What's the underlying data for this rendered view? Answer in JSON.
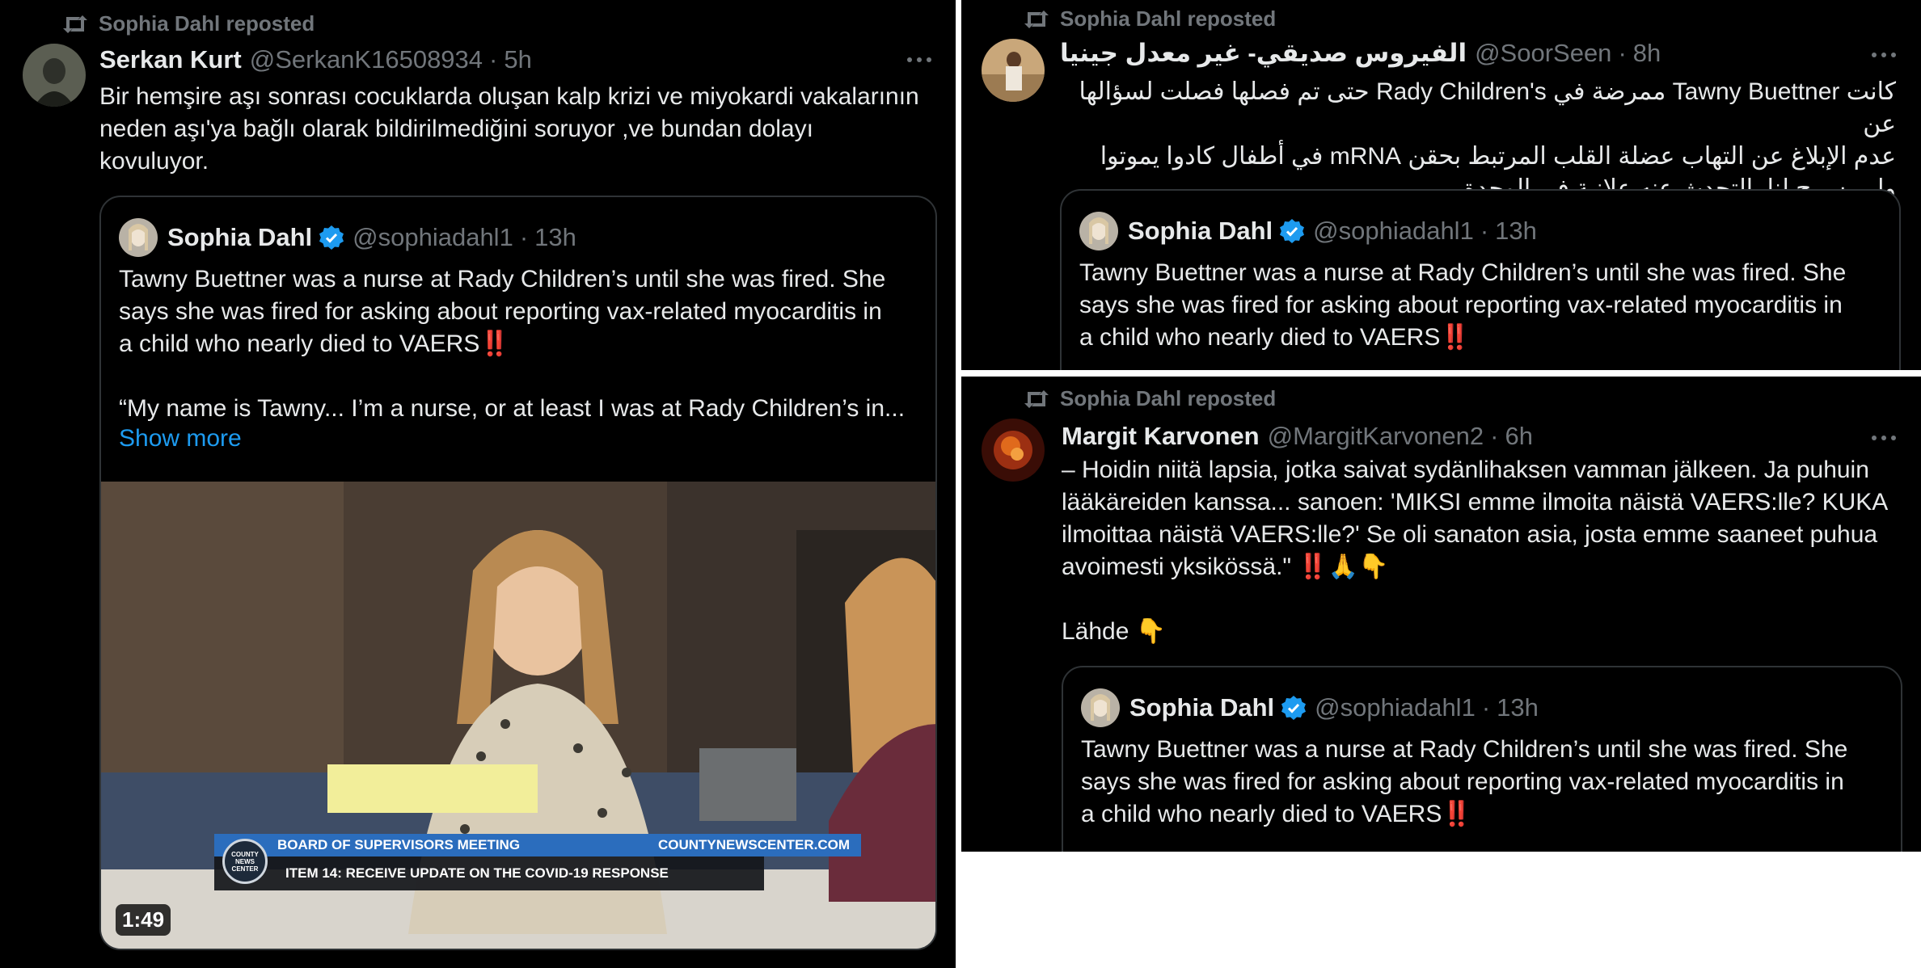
{
  "left": {
    "repost_label": "Sophia Dahl reposted",
    "author_name": "Serkan Kurt",
    "author_handle": "@SerkanK16508934",
    "separator": "·",
    "time": "5h",
    "text": "Bir hemşire aşı sonrası cocuklarda oluşan kalp krizi ve miyokardi vakalarının\nneden aşı'ya bağlı olarak bildirilmediğini soruyor ,ve bundan dolayı\nkovuluyor.",
    "quote": {
      "name": "Sophia Dahl",
      "handle": "@sophiadahl1",
      "time": "13h",
      "text_part1": "Tawny Buettner was a nurse at Rady Children’s until she was fired. She\nsays she was fired for asking about reporting vax-related myocarditis in\na child who nearly died to VAERS",
      "emoji_bang": "‼️",
      "text_part2": "“My name is Tawny... I’m a nurse, or at least I was at Rady Children’s in...",
      "show_more": "Show more"
    },
    "video": {
      "banner_title": "BOARD OF SUPERVISORS MEETING",
      "banner_site": "COUNTYNEWSCENTER.COM",
      "banner_item": "ITEM 14: RECEIVE UPDATE ON THE COVID-19 RESPONSE",
      "logo_text": "COUNTY NEWS CENTER",
      "duration": "1:49"
    }
  },
  "top_right": {
    "repost_label": "Sophia Dahl reposted",
    "author_name": "الفيروس صديقي- غير معدل جينيا",
    "author_handle": "@SoorSeen",
    "separator": "·",
    "time": "8h",
    "text": "كانت Tawny Buettner ممرضة في Rady Children's حتى تم فصلها فصلت لسؤالها عن\nعدم الإبلاغ عن التهاب عضلة القلب المرتبط بحقن mRNA في أطفال كادوا يموتوا\nولم يسمح لنا بالتحدث عنه علانية في الوحدة",
    "quote": {
      "name": "Sophia Dahl",
      "handle": "@sophiadahl1",
      "time": "13h",
      "text_part1": "Tawny Buettner was a nurse at Rady Children’s until she was fired. She\nsays she was fired for asking about reporting vax-related myocarditis in\na child who nearly died to VAERS",
      "emoji_bang": "‼️"
    }
  },
  "bottom_right": {
    "repost_label": "Sophia Dahl reposted",
    "author_name": "Margit Karvonen",
    "author_handle": "@MargitKarvonen2",
    "separator": "·",
    "time": "6h",
    "text": "– Hoidin niitä lapsia, jotka saivat sydänlihaksen vamman jälkeen. Ja puhuin\nlääkäreiden kanssa... sanoen: 'MIKSI emme ilmoita näistä VAERS:lle? KUKA\nilmoittaa näistä VAERS:lle?' Se oli sanaton asia, josta emme saaneet puhua\navoimesti yksikössä.\"",
    "text_emojis": "‼️🙏👇",
    "source_label": "Lähde",
    "source_emoji": "👇",
    "quote": {
      "name": "Sophia Dahl",
      "handle": "@sophiadahl1",
      "time": "13h",
      "text_part1": "Tawny Buettner was a nurse at Rady Children’s until she was fired. She\nsays she was fired for asking about reporting vax-related myocarditis in\na child who nearly died to VAERS",
      "emoji_bang": "‼️"
    }
  },
  "colors": {
    "background": "#000000",
    "text": "#e7e9ea",
    "muted": "#71767b",
    "link": "#1d9bf0",
    "border": "#2f3336",
    "verified": "#1d9bf0",
    "bang": "#e0245e"
  }
}
